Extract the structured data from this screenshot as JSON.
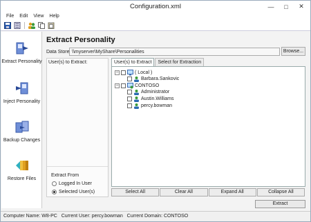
{
  "window": {
    "title": "Configuration.xml",
    "controls": [
      "—",
      "□",
      "✕"
    ]
  },
  "menu": [
    "File",
    "Edit",
    "View",
    "Help"
  ],
  "toolbar": {
    "icons": [
      "save-icon",
      "database-icon",
      "users-icon",
      "copy-icon",
      "paste-icon"
    ]
  },
  "sidebar": {
    "items": [
      {
        "label": "Extract Personality",
        "icon": "extract-personality-icon"
      },
      {
        "label": "Inject Personality",
        "icon": "inject-personality-icon"
      },
      {
        "label": "Backup Changes",
        "icon": "backup-changes-icon"
      },
      {
        "label": "Restore Files",
        "icon": "restore-files-icon"
      }
    ]
  },
  "main": {
    "heading": "Extract Personality",
    "data_store_label": "Data Store",
    "data_store_value": "\\\\myserver\\MyShare\\Personalities",
    "browse_label": "Browse...",
    "users_to_extract_label": "User(s) to Extract:",
    "extract_from": {
      "title": "Extract From",
      "options": [
        {
          "label": "Logged In User",
          "selected": false
        },
        {
          "label": "Selected User(s)",
          "selected": true
        }
      ]
    },
    "tabs": [
      {
        "label": "User(s) to Extract",
        "active": true
      },
      {
        "label": "Select for Extraction",
        "active": false
      }
    ],
    "tree": [
      {
        "label": "( Local )",
        "type": "group",
        "expander": "−",
        "children": [
          {
            "label": "Barbara.Sankovic"
          }
        ]
      },
      {
        "label": "CONTOSO",
        "type": "group",
        "expander": "−",
        "children": [
          {
            "label": "Administrator"
          },
          {
            "label": "Austin.Williams"
          },
          {
            "label": "percy.bowman"
          }
        ]
      }
    ],
    "buttons": [
      "Select All",
      "Clear All",
      "Expand All",
      "Collapse All"
    ],
    "extract_button": "Extract"
  },
  "status": {
    "computer": "Computer Name: W8-PC",
    "user": "Current User: percy.bowman",
    "domain": "Current Domain: CONTOSO"
  }
}
